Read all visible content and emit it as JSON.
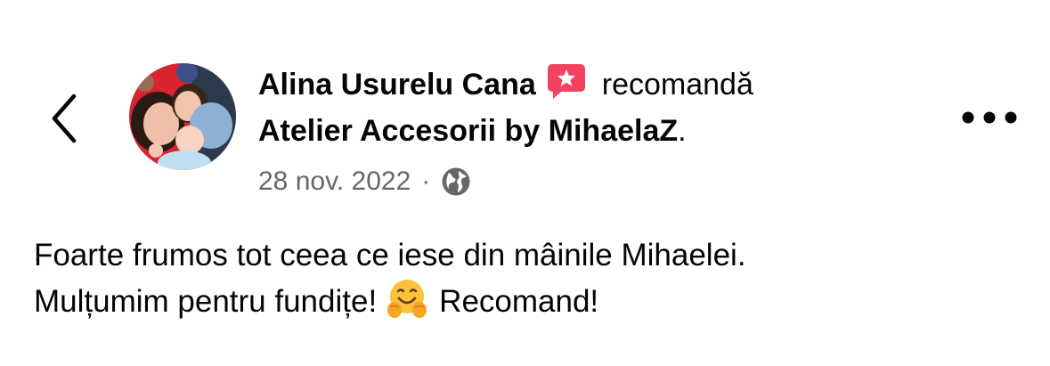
{
  "post": {
    "author": "Alina Usurelu Cana",
    "action": "recomandă",
    "page_name": "Atelier Accesorii by MihaelaZ",
    "page_suffix": ".",
    "date": "28 nov. 2022",
    "separator": "·",
    "privacy_icon": "globe-icon",
    "text_line1": "Foarte frumos tot ceea ce iese din mâinile Mihaelei.",
    "text_line2_before": "Mulțumim pentru fundițe!",
    "emoji": "hugging-face-emoji",
    "text_line2_after": "Recomand!"
  },
  "icons": {
    "back": "chevron-left-icon",
    "more": "ellipsis-icon",
    "recommend": "recommend-star-icon"
  },
  "colors": {
    "text": "#050505",
    "secondary": "#65676b",
    "recommend_badge": "#f3425f"
  }
}
